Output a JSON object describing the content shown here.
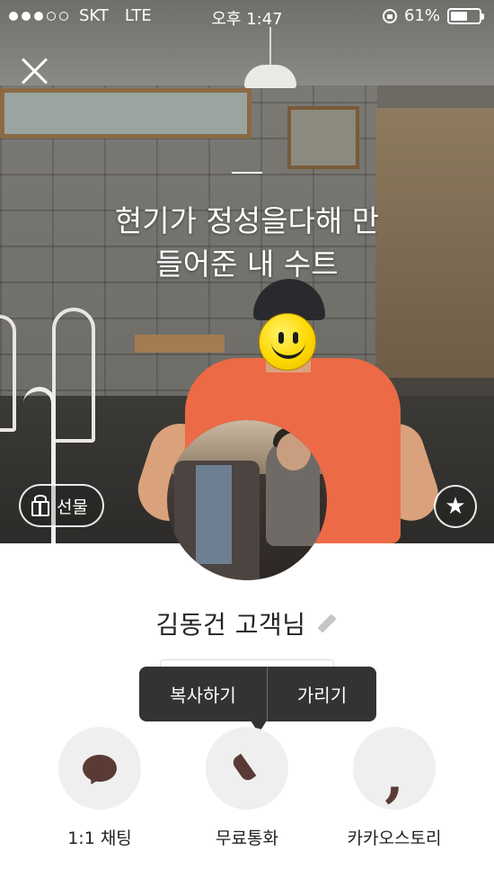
{
  "status_bar": {
    "carrier": "SKT",
    "network": "LTE",
    "time": "오후 1:47",
    "battery_percent": "61%",
    "battery_level": 0.61,
    "signal_bars_filled": 3,
    "signal_bars_total": 5
  },
  "profile": {
    "status_message_line1": "현기가 정성을다해 만",
    "status_message_line2": "들어준 내 수트",
    "name": "김동건 고객님",
    "gift_label": "선물"
  },
  "tooltip": {
    "copy_label": "복사하기",
    "hide_label": "가리기"
  },
  "actions": [
    {
      "label": "1:1 채팅",
      "icon": "chat-bubble-icon"
    },
    {
      "label": "무료통화",
      "icon": "phone-icon"
    },
    {
      "label": "카카오스토리",
      "icon": "kakaostory-icon"
    }
  ],
  "colors": {
    "accent_brown": "#5a3a34",
    "tooltip_bg": "#333333",
    "action_circle": "#efefef"
  }
}
